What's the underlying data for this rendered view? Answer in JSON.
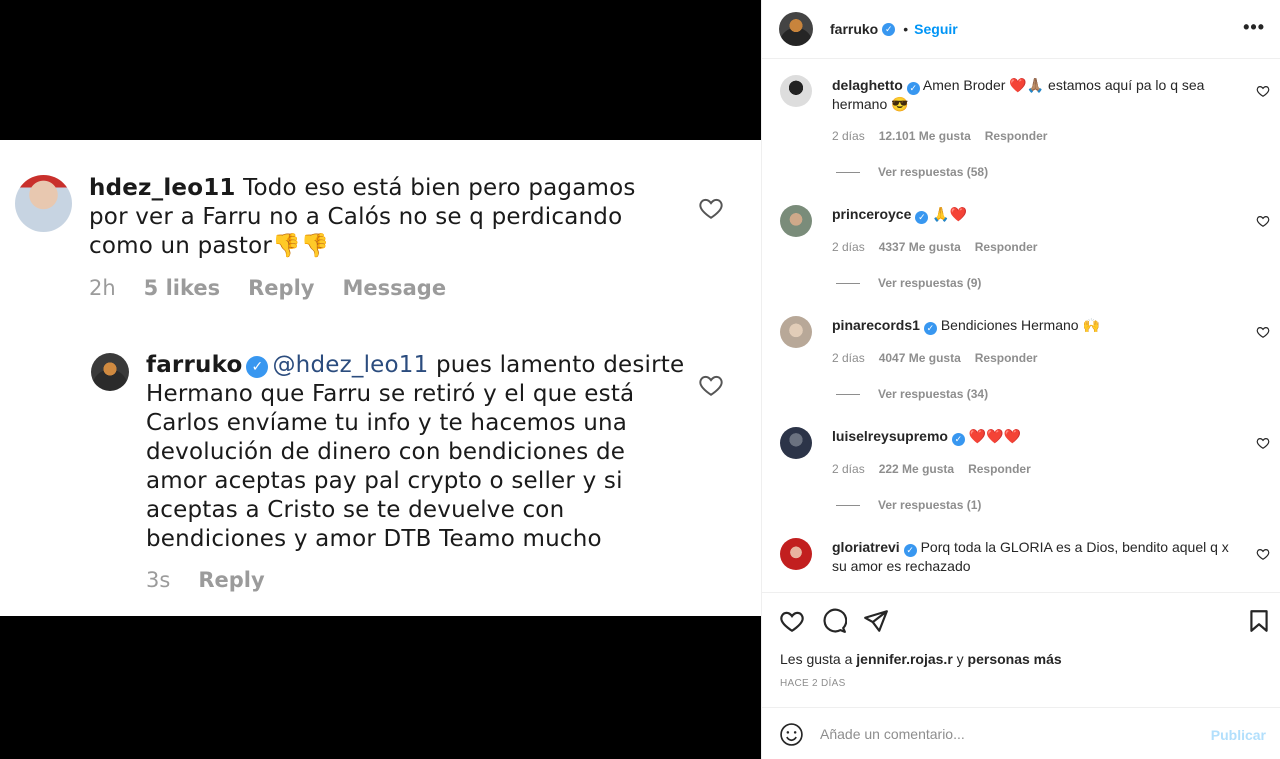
{
  "media": {
    "comment1": {
      "username": "hdez_leo11",
      "text": "Todo eso está bien pero pagamos por ver a Farru no a Calós no se q perdicando como un pastor👎👎",
      "time": "2h",
      "likes": "5 likes",
      "reply": "Reply",
      "message": "Message"
    },
    "comment2": {
      "username": "farruko",
      "mention": "@hdez_leo11",
      "text": "pues lamento desirte Hermano que Farru se retiró y el que está Carlos envíame tu info y te hacemos una devolución de dinero con bendiciones de amor aceptas pay pal crypto o seller y si aceptas a Cristo se te devuelve con bendiciones y amor DTB Teamo mucho",
      "time": "3s",
      "reply": "Reply"
    }
  },
  "header": {
    "username": "farruko",
    "dot": "•",
    "follow": "Seguir",
    "more": "•••"
  },
  "comments": [
    {
      "username": "delaghetto",
      "text": "Amen Broder ❤️🙏🏽 estamos aquí pa lo q sea hermano 😎",
      "age": "2 días",
      "likes": "12.101 Me gusta",
      "reply": "Responder",
      "view_replies": "Ver respuestas (58)"
    },
    {
      "username": "princeroyce",
      "text": "🙏❤️",
      "age": "2 días",
      "likes": "4337 Me gusta",
      "reply": "Responder",
      "view_replies": "Ver respuestas (9)"
    },
    {
      "username": "pinarecords1",
      "text": "Bendiciones Hermano 🙌",
      "age": "2 días",
      "likes": "4047 Me gusta",
      "reply": "Responder",
      "view_replies": "Ver respuestas (34)"
    },
    {
      "username": "luiselreysupremo",
      "text": "❤️❤️❤️",
      "age": "2 días",
      "likes": "222 Me gusta",
      "reply": "Responder",
      "view_replies": "Ver respuestas (1)"
    },
    {
      "username": "gloriatrevi",
      "text": "Porq toda la GLORIA es a Dios, bendito aquel q x su amor es rechazado"
    }
  ],
  "likes": {
    "prefix": "Les gusta a",
    "user": "jennifer.rojas.r",
    "connector": "y",
    "others": "personas más"
  },
  "timestamp": "HACE 2 DÍAS",
  "add_comment": {
    "placeholder": "Añade un comentario...",
    "publish": "Publicar"
  }
}
